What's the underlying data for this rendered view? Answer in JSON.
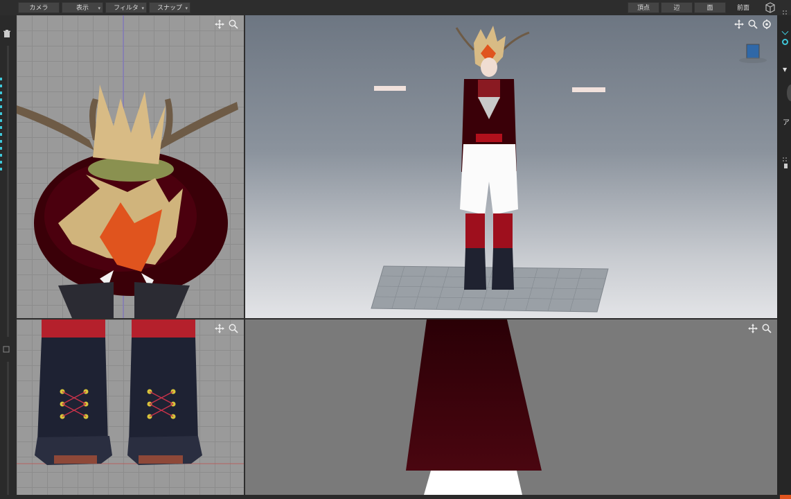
{
  "toolbar": {
    "camera_label": "カメラ",
    "view_label": "表示",
    "filter_label": "フィルタ",
    "snap_label": "スナップ",
    "vertex_label": "頂点",
    "edge_label": "辺",
    "face_label": "面",
    "front_label": "前面"
  },
  "right_panel": {
    "partial_text": "ア"
  },
  "colors": {
    "panel_bg": "#2b2b2b",
    "grid_bg": "#9a9a9a",
    "accent": "#3ec7d9",
    "coat_dark": "#3a0008"
  }
}
